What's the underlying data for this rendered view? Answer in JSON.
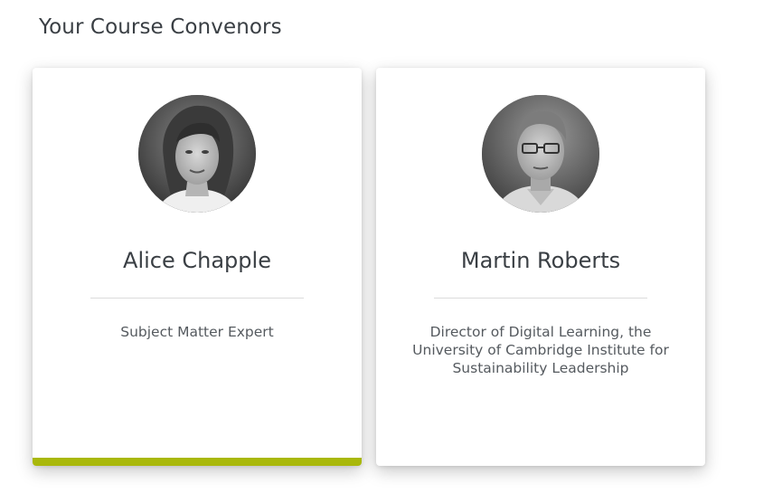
{
  "section": {
    "title": "Your Course Convenors"
  },
  "convenors": [
    {
      "name": "Alice Chapple",
      "role": "Subject Matter Expert",
      "photo_alt": "Alice Chapple",
      "highlighted": true
    },
    {
      "name": "Martin Roberts",
      "role": "Director of Digital Learning, the University of Cambridge Institute for Sustainability Leadership",
      "photo_alt": "Martin Roberts",
      "highlighted": false
    }
  ],
  "colors": {
    "accent": "#a9b80a",
    "heading_text": "#3a3f44",
    "body_text": "#555a5f",
    "divider": "#dcdcdc"
  }
}
